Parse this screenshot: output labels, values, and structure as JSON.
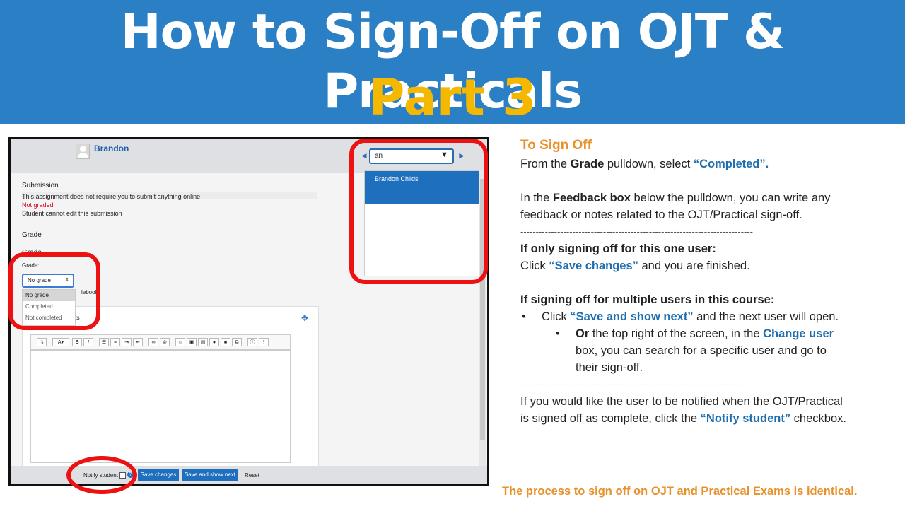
{
  "header": {
    "title": "How to Sign-Off on OJT & Practicals",
    "subtitle": "Part 3"
  },
  "screenshot": {
    "user_name": "Brandon",
    "change_user_value": "an",
    "change_user_option": "Brandon Childs",
    "submission_heading": "Submission",
    "submission_status": "This assignment does not require you to submit anything online",
    "grading_status": "Not graded",
    "edit_status": "Student cannot edit this submission",
    "grade_heading": "Grade",
    "grade_subheading": "Grade",
    "grade_label": "Grade:",
    "grade_value": "No grade",
    "grade_options": [
      "No grade",
      "Completed",
      "Not completed"
    ],
    "gradebook_fragment": "lebook",
    "feedback_fragment": "nts",
    "notify_label": "Notify student",
    "save_changes": "Save changes",
    "save_and_show_next": "Save and show next",
    "reset": "Reset"
  },
  "instructions": {
    "heading": "To Sign Off",
    "p1_a": "From the ",
    "p1_b": "Grade",
    "p1_c": " pulldown, select ",
    "p1_d": "“Completed”.",
    "p2_a": "In the ",
    "p2_b": "Feedback box",
    "p2_c": " below the pulldown, you can write any feedback or notes related to the OJT/Practical sign-off.",
    "divider": "----------------------------------------------------------------------------",
    "single_heading": "If only signing off for this one user:",
    "single_a": "Click ",
    "single_b": "“Save changes”",
    "single_c": " and you are finished.",
    "multi_heading": "If signing off for multiple users in this course:",
    "bullet1_a": "Click ",
    "bullet1_b": "“Save and show next”",
    "bullet1_c": " and the next user will open.",
    "bullet2_a": "Or",
    "bullet2_b": " the top right of the screen, in the ",
    "bullet2_c": "Change user",
    "bullet2_d": " box, you can search for a specific user and go to their sign-off.",
    "divider2": "---------------------------------------------------------------------------",
    "notify_a": "If you would like the user to be notified when the OJT/Practical is signed off as complete, click the ",
    "notify_b": "“Notify student”",
    "notify_c": " checkbox.",
    "footer_note": "The process to sign off on OJT and Practical Exams is identical."
  },
  "colors": {
    "banner": "#2b80c5",
    "subtitle": "#f5b800",
    "highlight_ring": "#ee1111",
    "accent_orange": "#e8902a",
    "link_blue": "#1f6fb0"
  }
}
